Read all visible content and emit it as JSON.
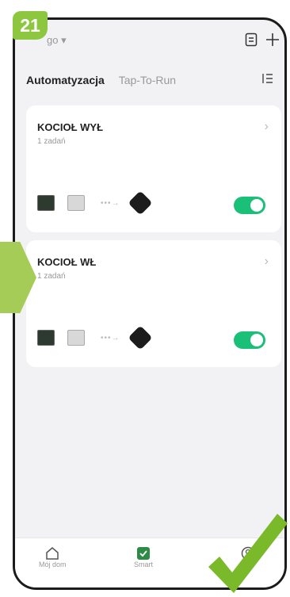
{
  "badge": "21",
  "header": {
    "home_label": "go ▾"
  },
  "tabs": {
    "active": "Automatyzacja",
    "other": "Tap-To-Run"
  },
  "cards": [
    {
      "title": "KOCIOŁ WYŁ",
      "subtitle": "1 zadań",
      "enabled": true
    },
    {
      "title": "KOCIOŁ WŁ",
      "subtitle": "1 zadań",
      "enabled": true
    }
  ],
  "nav": {
    "home": "Mój dom",
    "smart": "Smart"
  },
  "colors": {
    "accent": "#1ac077",
    "annotation": "#8dc63f"
  }
}
